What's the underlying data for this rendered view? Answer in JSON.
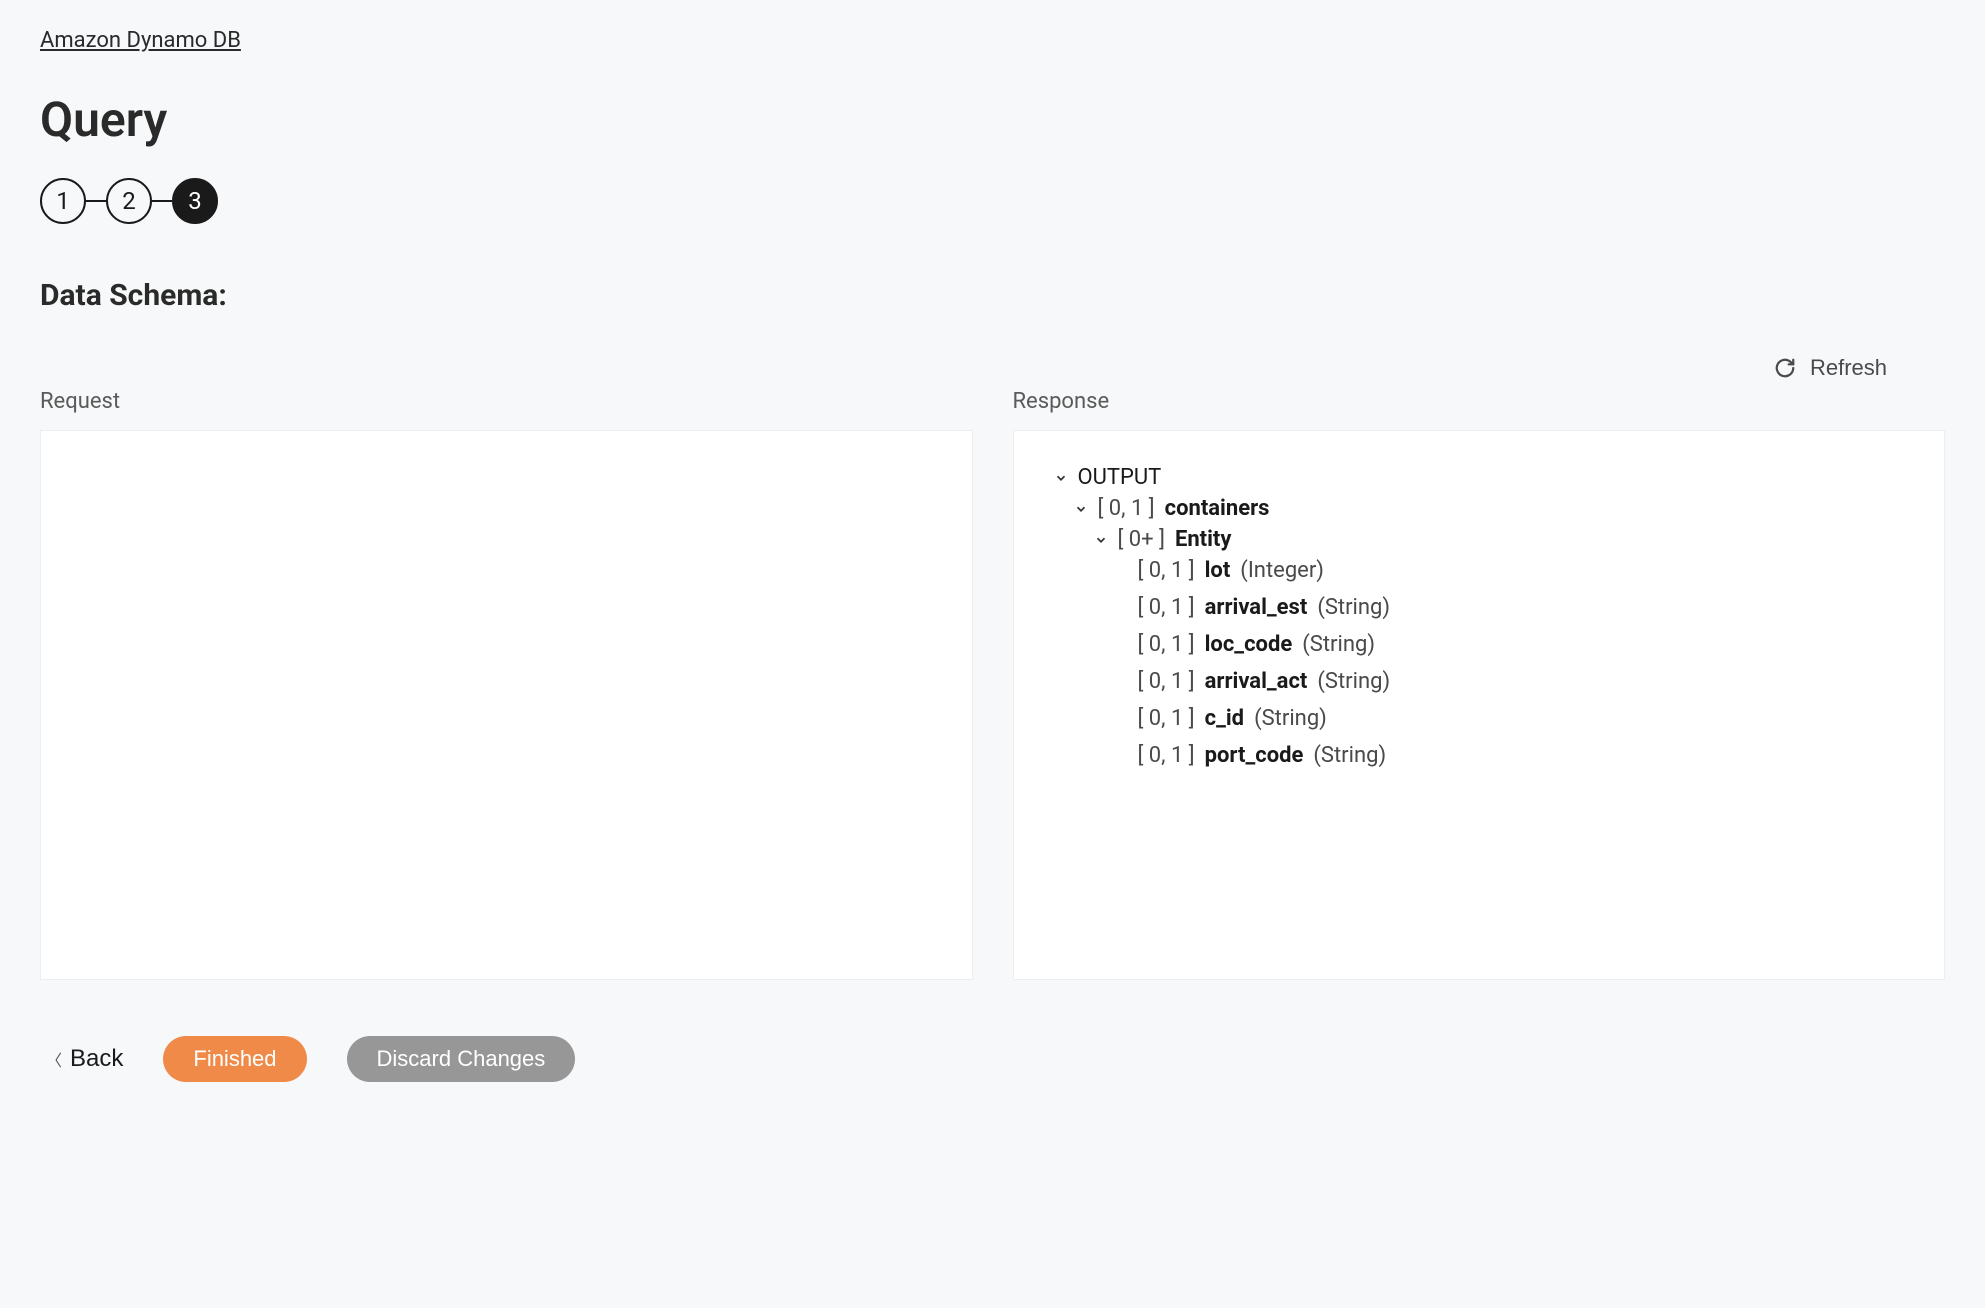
{
  "breadcrumb": {
    "label": "Amazon Dynamo DB"
  },
  "page": {
    "title": "Query"
  },
  "stepper": {
    "steps": [
      "1",
      "2",
      "3"
    ],
    "active_index": 2
  },
  "section": {
    "title": "Data Schema:"
  },
  "refresh": {
    "label": "Refresh"
  },
  "panels": {
    "request": {
      "label": "Request"
    },
    "response": {
      "label": "Response",
      "tree": {
        "root": {
          "label": "OUTPUT"
        },
        "level1": {
          "card": "[ 0, 1 ]",
          "name": "containers"
        },
        "level2": {
          "card": "[ 0+ ]",
          "name": "Entity"
        },
        "fields": [
          {
            "card": "[ 0, 1 ]",
            "name": "lot",
            "type": "(Integer)"
          },
          {
            "card": "[ 0, 1 ]",
            "name": "arrival_est",
            "type": "(String)"
          },
          {
            "card": "[ 0, 1 ]",
            "name": "loc_code",
            "type": "(String)"
          },
          {
            "card": "[ 0, 1 ]",
            "name": "arrival_act",
            "type": "(String)"
          },
          {
            "card": "[ 0, 1 ]",
            "name": "c_id",
            "type": "(String)"
          },
          {
            "card": "[ 0, 1 ]",
            "name": "port_code",
            "type": "(String)"
          }
        ]
      }
    }
  },
  "footer": {
    "back": "Back",
    "finished": "Finished",
    "discard": "Discard Changes"
  }
}
